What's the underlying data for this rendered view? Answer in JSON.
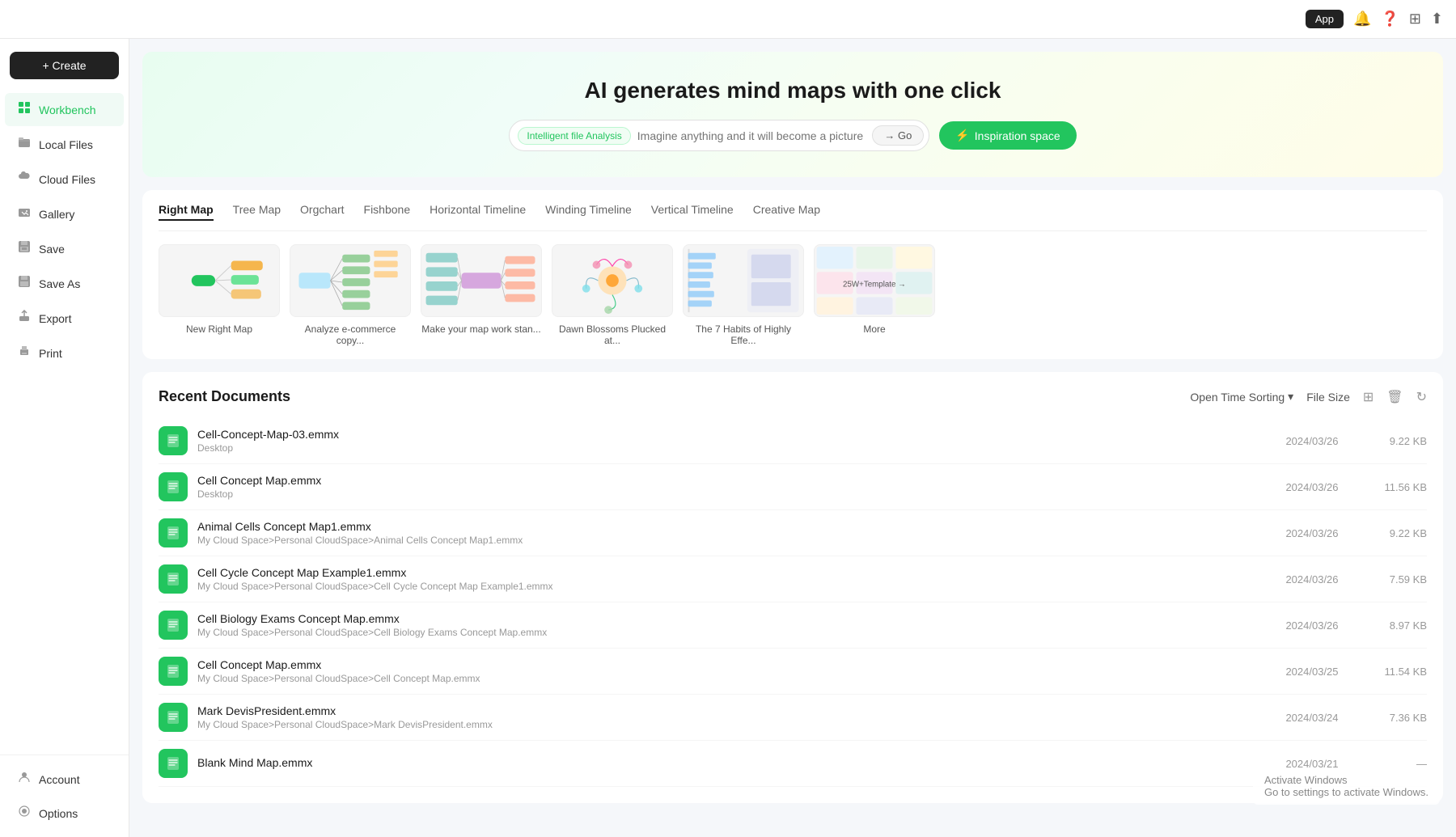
{
  "topbar": {
    "app_label": "App",
    "icons": [
      "bell",
      "question-circle",
      "grid",
      "upload"
    ]
  },
  "sidebar": {
    "create_label": "+ Create",
    "items": [
      {
        "id": "workbench",
        "label": "Workbench",
        "icon": "⊞",
        "active": true
      },
      {
        "id": "local-files",
        "label": "Local Files",
        "icon": "📁"
      },
      {
        "id": "cloud-files",
        "label": "Cloud Files",
        "icon": "☁"
      },
      {
        "id": "gallery",
        "label": "Gallery",
        "icon": "💬"
      },
      {
        "id": "save",
        "label": "Save",
        "icon": "💾"
      },
      {
        "id": "save-as",
        "label": "Save As",
        "icon": "💾"
      },
      {
        "id": "export",
        "label": "Export",
        "icon": "📤"
      },
      {
        "id": "print",
        "label": "Print",
        "icon": "🖨"
      }
    ],
    "bottom_items": [
      {
        "id": "account",
        "label": "Account",
        "icon": "👤"
      },
      {
        "id": "options",
        "label": "Options",
        "icon": "⚙"
      }
    ]
  },
  "hero": {
    "title": "AI generates mind maps with one click",
    "input_tag": "Intelligent file Analysis",
    "input_placeholder": "Imagine anything and it will become a picture",
    "go_label": "→ Go",
    "inspiration_label": "Inspiration space"
  },
  "templates": {
    "tabs": [
      {
        "id": "right-map",
        "label": "Right Map",
        "active": true
      },
      {
        "id": "tree-map",
        "label": "Tree Map",
        "active": false
      },
      {
        "id": "orgchart",
        "label": "Orgchart",
        "active": false
      },
      {
        "id": "fishbone",
        "label": "Fishbone",
        "active": false
      },
      {
        "id": "horizontal-timeline",
        "label": "Horizontal Timeline",
        "active": false
      },
      {
        "id": "winding-timeline",
        "label": "Winding Timeline",
        "active": false
      },
      {
        "id": "vertical-timeline",
        "label": "Vertical Timeline",
        "active": false
      },
      {
        "id": "creative-map",
        "label": "Creative Map",
        "active": false
      }
    ],
    "cards": [
      {
        "id": "new-right-map",
        "label": "New Right Map",
        "type": "rightmap"
      },
      {
        "id": "analyze-commerce",
        "label": "Analyze e-commerce copy...",
        "type": "commerce"
      },
      {
        "id": "make-map-work",
        "label": "Make your map work stan...",
        "type": "workstan"
      },
      {
        "id": "dawn-blossoms",
        "label": "Dawn Blossoms Plucked at...",
        "type": "dawn"
      },
      {
        "id": "7-habits",
        "label": "The 7 Habits of Highly Effe...",
        "type": "habits"
      },
      {
        "id": "more",
        "label": "More",
        "type": "more",
        "more_label": "25W+Template →"
      }
    ]
  },
  "recent": {
    "title": "Recent Documents",
    "sort_label": "Open Time Sorting",
    "file_size_label": "File Size",
    "documents": [
      {
        "name": "Cell-Concept-Map-03.emmx",
        "path": "Desktop",
        "date": "2024/03/26",
        "size": "9.22 KB"
      },
      {
        "name": "Cell Concept Map.emmx",
        "path": "Desktop",
        "date": "2024/03/26",
        "size": "11.56 KB"
      },
      {
        "name": "Animal Cells Concept Map1.emmx",
        "path": "My Cloud Space>Personal CloudSpace>Animal Cells Concept Map1.emmx",
        "date": "2024/03/26",
        "size": "9.22 KB"
      },
      {
        "name": "Cell Cycle Concept Map Example1.emmx",
        "path": "My Cloud Space>Personal CloudSpace>Cell Cycle Concept Map Example1.emmx",
        "date": "2024/03/26",
        "size": "7.59 KB"
      },
      {
        "name": "Cell Biology Exams Concept Map.emmx",
        "path": "My Cloud Space>Personal CloudSpace>Cell Biology Exams Concept Map.emmx",
        "date": "2024/03/26",
        "size": "8.97 KB"
      },
      {
        "name": "Cell Concept Map.emmx",
        "path": "My Cloud Space>Personal CloudSpace>Cell Concept Map.emmx",
        "date": "2024/03/25",
        "size": "11.54 KB"
      },
      {
        "name": "Mark DevisPresident.emmx",
        "path": "My Cloud Space>Personal CloudSpace>Mark DevisPresident.emmx",
        "date": "2024/03/24",
        "size": "7.36 KB"
      },
      {
        "name": "Blank Mind Map.emmx",
        "path": "",
        "date": "2024/03/21",
        "size": "—"
      }
    ]
  },
  "windows_activate": {
    "line1": "Activate Windows",
    "line2": "Go to settings to activate Windows."
  }
}
